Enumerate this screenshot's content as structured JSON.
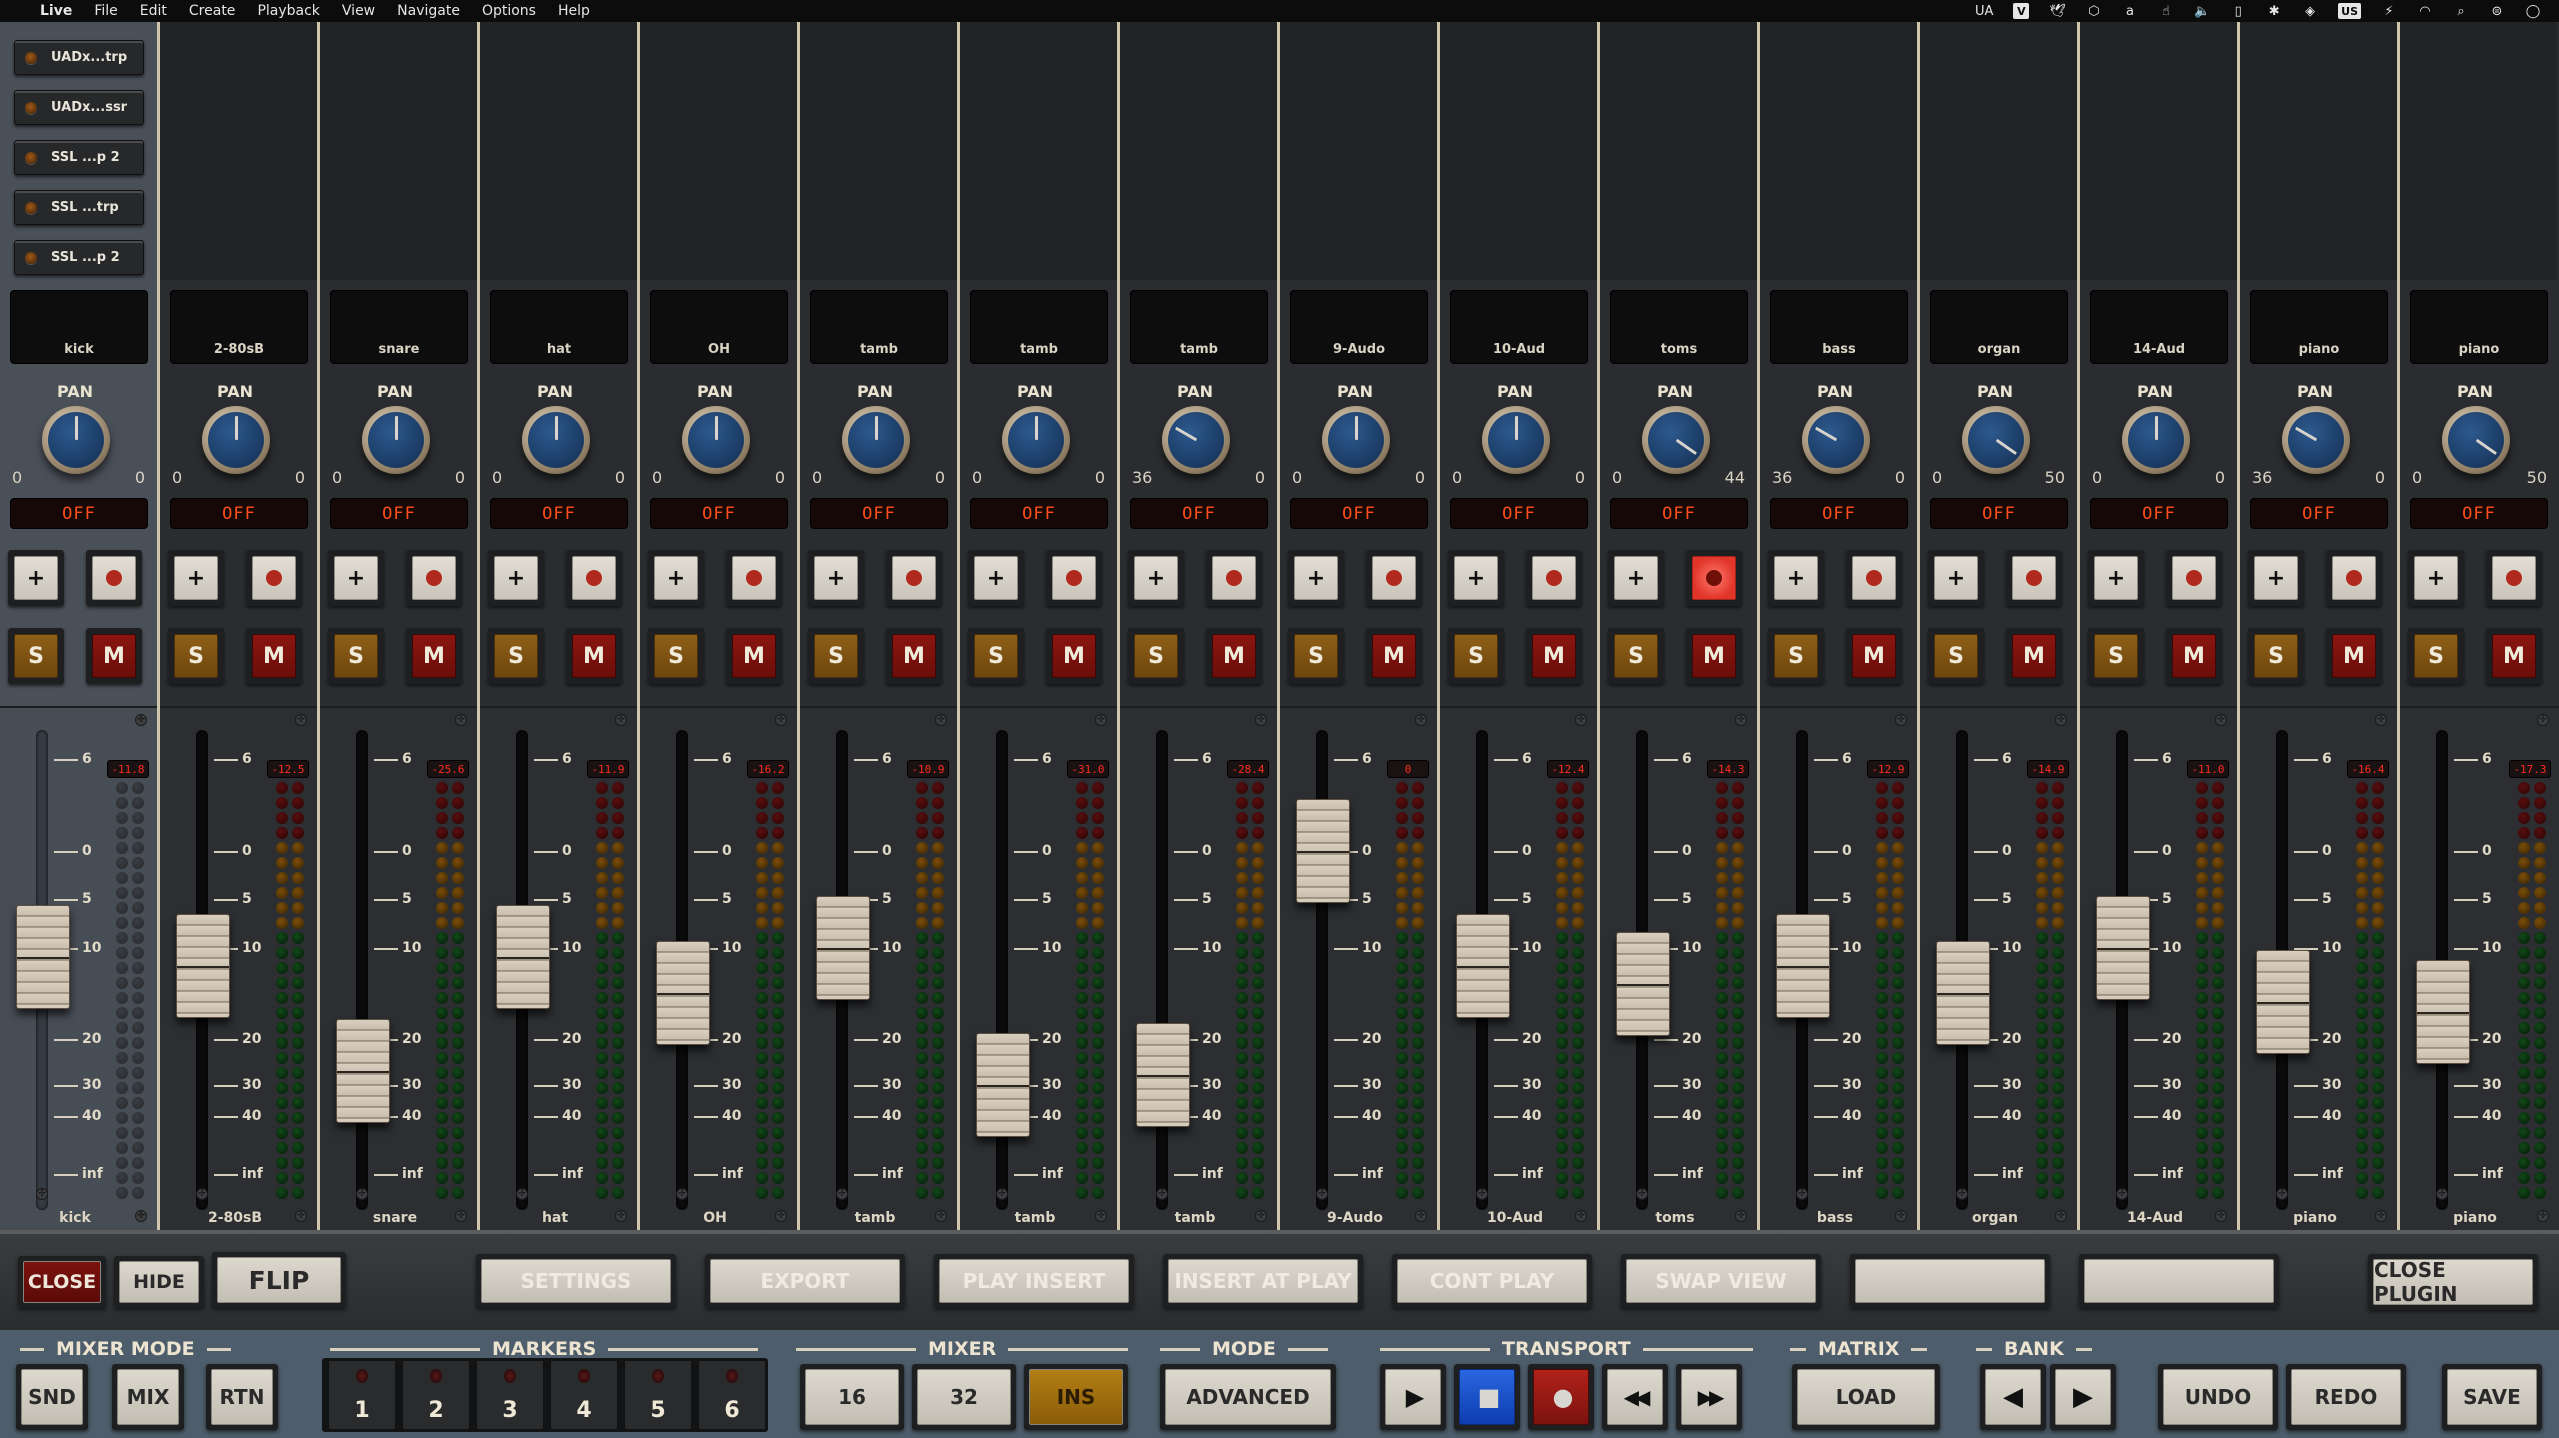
{
  "menubar": {
    "apple_icon": "apple-logo-icon",
    "app_name": "Live",
    "menus": [
      "File",
      "Edit",
      "Create",
      "Playback",
      "View",
      "Navigate",
      "Options",
      "Help"
    ],
    "status_items": [
      {
        "name": "ua-icon",
        "label": "UA"
      },
      {
        "name": "v-icon",
        "label": "V"
      },
      {
        "name": "bird-icon",
        "label": "🕊"
      },
      {
        "name": "layers-icon",
        "label": "⬡"
      },
      {
        "name": "script-a-icon",
        "label": "a"
      },
      {
        "name": "hand-pointer-icon",
        "label": "☝"
      },
      {
        "name": "volume-icon",
        "label": "🔈"
      },
      {
        "name": "tablet-icon",
        "label": "▯"
      },
      {
        "name": "bluetooth-icon",
        "label": "✱"
      },
      {
        "name": "ua-diamond-icon",
        "label": "◈"
      },
      {
        "name": "keyboard-layout-icon",
        "label": "US"
      },
      {
        "name": "battery-icon",
        "label": "⚡"
      },
      {
        "name": "wifi-icon",
        "label": "◠"
      },
      {
        "name": "search-icon",
        "label": "⌕"
      },
      {
        "name": "control-center-icon",
        "label": "⊜"
      },
      {
        "name": "siri-icon",
        "label": "◯"
      }
    ]
  },
  "inserts": [
    "UADx...trp",
    "UADx...ssr",
    "SSL ...p 2",
    "SSL ...trp",
    "SSL ...p 2"
  ],
  "strip_labels": {
    "pan": "PAN",
    "solo": "S",
    "mute": "M",
    "plus": "+"
  },
  "fader_scale": [
    "6",
    "0",
    "5",
    "10",
    "20",
    "30",
    "40",
    "inf"
  ],
  "channels": [
    {
      "name": "kick",
      "pan_l": "0",
      "pan_r": "0",
      "pan_dir": "center",
      "mode": "OFF",
      "rec_armed": false,
      "peak": "-11.8",
      "fader_db": "-11",
      "meter_active": false
    },
    {
      "name": "2-80sB",
      "pan_l": "0",
      "pan_r": "0",
      "pan_dir": "center",
      "mode": "OFF",
      "rec_armed": false,
      "peak": "-12.5",
      "fader_db": "-12",
      "meter_active": true
    },
    {
      "name": "snare",
      "pan_l": "0",
      "pan_r": "0",
      "pan_dir": "center",
      "mode": "OFF",
      "rec_armed": false,
      "peak": "-25.6",
      "fader_db": "-27",
      "meter_active": true
    },
    {
      "name": "hat",
      "pan_l": "0",
      "pan_r": "0",
      "pan_dir": "center",
      "mode": "OFF",
      "rec_armed": false,
      "peak": "-11.9",
      "fader_db": "-11",
      "meter_active": true
    },
    {
      "name": "OH",
      "pan_l": "0",
      "pan_r": "0",
      "pan_dir": "center",
      "mode": "OFF",
      "rec_armed": false,
      "peak": "-16.2",
      "fader_db": "-15",
      "meter_active": true
    },
    {
      "name": "tamb",
      "pan_l": "0",
      "pan_r": "0",
      "pan_dir": "center",
      "mode": "OFF",
      "rec_armed": false,
      "peak": "-10.9",
      "fader_db": "-10",
      "meter_active": true
    },
    {
      "name": "tamb",
      "pan_l": "0",
      "pan_r": "0",
      "pan_dir": "center",
      "mode": "OFF",
      "rec_armed": false,
      "peak": "-31.0",
      "fader_db": "-30",
      "meter_active": true
    },
    {
      "name": "tamb",
      "pan_l": "36",
      "pan_r": "0",
      "pan_dir": "left",
      "mode": "OFF",
      "rec_armed": false,
      "peak": "-28.4",
      "fader_db": "-28",
      "meter_active": true
    },
    {
      "name": "9-Audo",
      "pan_l": "0",
      "pan_r": "0",
      "pan_dir": "center",
      "mode": "OFF",
      "rec_armed": false,
      "peak": "0",
      "fader_db": "0",
      "meter_active": true
    },
    {
      "name": "10-Aud",
      "pan_l": "0",
      "pan_r": "0",
      "pan_dir": "center",
      "mode": "OFF",
      "rec_armed": false,
      "peak": "-12.4",
      "fader_db": "-12",
      "meter_active": true
    },
    {
      "name": "toms",
      "pan_l": "0",
      "pan_r": "44",
      "pan_dir": "right",
      "mode": "OFF",
      "rec_armed": true,
      "peak": "-14.3",
      "fader_db": "-14",
      "meter_active": true
    },
    {
      "name": "bass",
      "pan_l": "36",
      "pan_r": "0",
      "pan_dir": "left",
      "mode": "OFF",
      "rec_armed": false,
      "peak": "-12.9",
      "fader_db": "-12",
      "meter_active": true
    },
    {
      "name": "organ",
      "pan_l": "0",
      "pan_r": "50",
      "pan_dir": "right",
      "mode": "OFF",
      "rec_armed": false,
      "peak": "-14.9",
      "fader_db": "-15",
      "meter_active": true
    },
    {
      "name": "14-Aud",
      "pan_l": "0",
      "pan_r": "0",
      "pan_dir": "center",
      "mode": "OFF",
      "rec_armed": false,
      "peak": "-11.0",
      "fader_db": "-10",
      "meter_active": true
    },
    {
      "name": "piano",
      "pan_l": "36",
      "pan_r": "0",
      "pan_dir": "left",
      "mode": "OFF",
      "rec_armed": false,
      "peak": "-16.4",
      "fader_db": "-16",
      "meter_active": true
    },
    {
      "name": "piano",
      "pan_l": "0",
      "pan_r": "50",
      "pan_dir": "right",
      "mode": "OFF",
      "rec_armed": false,
      "peak": "-17.3",
      "fader_db": "-17",
      "meter_active": true
    }
  ],
  "top_buttons": {
    "close": "CLOSE",
    "hide": "HIDE",
    "flip": "FLIP",
    "settings": "SETTINGS",
    "export": "EXPORT",
    "play_insert": "PLAY INSERT",
    "insert_at_play": "INSERT AT PLAY",
    "cont_play": "CONT PLAY",
    "swap_view": "SWAP VIEW",
    "blank1": "",
    "blank2": "",
    "close_plugin": "CLOSE PLUGIN"
  },
  "sections": {
    "mixer_mode": {
      "label": "MIXER MODE",
      "buttons": [
        "SND",
        "MIX",
        "RTN"
      ]
    },
    "markers": {
      "label": "MARKERS",
      "buttons": [
        "1",
        "2",
        "3",
        "4",
        "5",
        "6"
      ]
    },
    "mixer": {
      "label": "MIXER",
      "buttons": [
        "16",
        "32",
        "INS"
      ],
      "active": "INS"
    },
    "mode": {
      "label": "MODE",
      "value": "ADVANCED"
    },
    "transport": {
      "label": "TRANSPORT",
      "buttons": [
        {
          "name": "play-button",
          "icon": "play-icon",
          "glyph": "▶"
        },
        {
          "name": "stop-button",
          "icon": "stop-icon",
          "glyph": "■",
          "active": true
        },
        {
          "name": "record-button",
          "icon": "record-icon",
          "glyph": "●",
          "active": true
        },
        {
          "name": "rewind-button",
          "icon": "rewind-icon",
          "glyph": "◀◀"
        },
        {
          "name": "fast-forward-button",
          "icon": "fast-forward-icon",
          "glyph": "▶▶"
        }
      ]
    },
    "matrix": {
      "label": "MATRIX",
      "load": "LOAD"
    },
    "bank": {
      "label": "BANK",
      "prev": "◀",
      "next": "▶"
    },
    "undo": "UNDO",
    "redo": "REDO",
    "save": "SAVE"
  },
  "colors": {
    "accent_amber": "#b37e14",
    "mute_red": "#8b1510",
    "stop_blue": "#2a66e0",
    "off_text": "#ff4d1a",
    "peak_text": "#ff2b1d"
  }
}
